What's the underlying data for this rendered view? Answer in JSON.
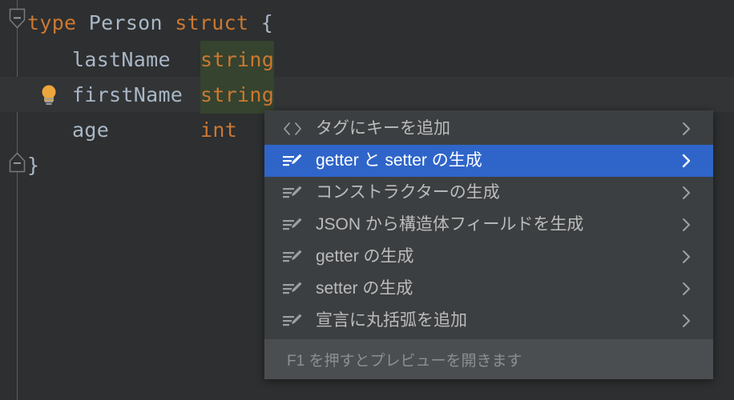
{
  "editor": {
    "background": "#2d2f30",
    "current_line_background": "#323436",
    "occurrence_highlight": "#35432f",
    "keyword_color": "#cc7832",
    "identifier_color": "#a9b7c6",
    "lines": [
      {
        "id": "line-1",
        "fold": "collapse-start",
        "tokens": [
          {
            "text": "type",
            "style": "kw"
          },
          {
            "text": " ",
            "style": "punc"
          },
          {
            "text": "Person",
            "style": "id"
          },
          {
            "text": " ",
            "style": "punc"
          },
          {
            "text": "struct",
            "style": "kw"
          },
          {
            "text": " ",
            "style": "punc"
          },
          {
            "text": "{",
            "style": "punc"
          }
        ]
      },
      {
        "id": "line-2",
        "fold": "none",
        "tokens": [
          {
            "text": "    lastName  ",
            "style": "id"
          },
          {
            "text": "string",
            "style": "type-hl"
          }
        ]
      },
      {
        "id": "line-3",
        "fold": "none",
        "bulb": true,
        "current": true,
        "tokens": [
          {
            "text": "    firstName ",
            "style": "id"
          },
          {
            "text": "string",
            "style": "type-hl"
          }
        ]
      },
      {
        "id": "line-4",
        "fold": "none",
        "tokens": [
          {
            "text": "    age       ",
            "style": "id"
          },
          {
            "text": "int",
            "style": "kw"
          }
        ]
      },
      {
        "id": "line-5",
        "fold": "collapse-end",
        "tokens": [
          {
            "text": "}",
            "style": "punc"
          }
        ]
      }
    ],
    "gutter_bulb_icon": "lightbulb-icon",
    "fold_icon": "fold-collapse-icon"
  },
  "menu": {
    "selected_index": 1,
    "selection_color": "#2f65c9",
    "background": "#3c3f41",
    "items": [
      {
        "icon": "angle-brackets-icon",
        "label": "タグにキーを追加",
        "submenu": true
      },
      {
        "icon": "generate-pencil-icon",
        "label": "getter と setter の生成",
        "submenu": true
      },
      {
        "icon": "generate-pencil-icon",
        "label": "コンストラクターの生成",
        "submenu": true
      },
      {
        "icon": "generate-pencil-icon",
        "label": "JSON から構造体フィールドを生成",
        "submenu": true
      },
      {
        "icon": "generate-pencil-icon",
        "label": "getter の生成",
        "submenu": true
      },
      {
        "icon": "generate-pencil-icon",
        "label": "setter の生成",
        "submenu": true
      },
      {
        "icon": "generate-pencil-icon",
        "label": "宣言に丸括弧を追加",
        "submenu": true
      }
    ],
    "footer": {
      "hint": "F1 を押すとプレビューを開きます"
    }
  }
}
